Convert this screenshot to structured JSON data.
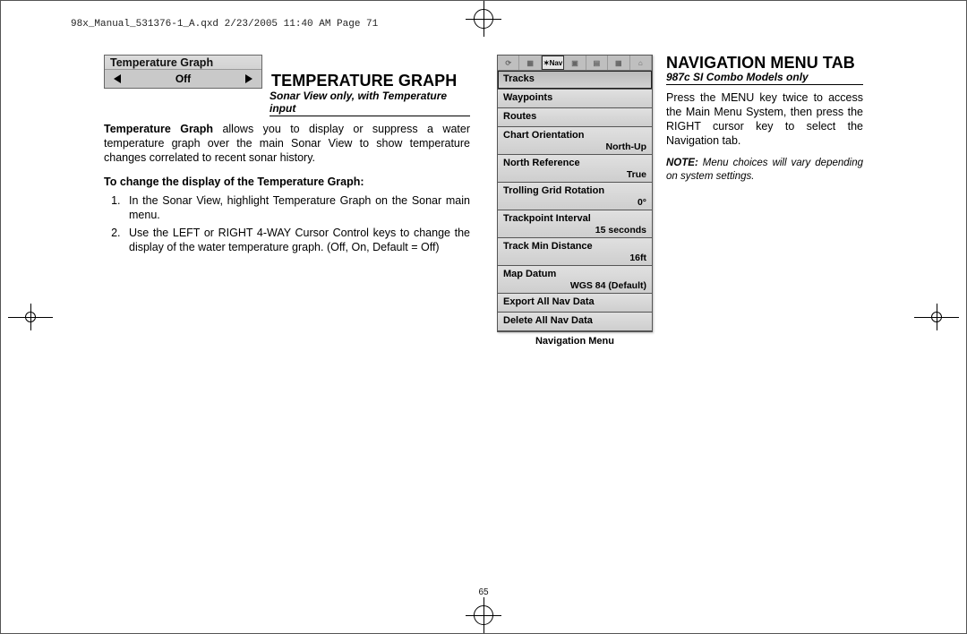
{
  "print_header": "98x_Manual_531376-1_A.qxd  2/23/2005  11:40 AM  Page 71",
  "page_number": "65",
  "left": {
    "widget_title": "Temperature Graph",
    "widget_value": "Off",
    "title": "TEMPERATURE GRAPH",
    "subtitle": "Sonar View only, with Temperature input",
    "intro_bold": "Temperature Graph",
    "intro_rest": " allows you to display or suppress a water temperature graph over the main Sonar View to show temperature changes correlated to recent sonar history.",
    "howto": "To change the display of the Temperature Graph:",
    "steps": [
      "In the Sonar View, highlight Temperature Graph on the Sonar main menu.",
      "Use the LEFT or RIGHT 4-WAY Cursor Control keys to change the display of the water temperature graph. (Off, On, Default = Off)"
    ]
  },
  "right": {
    "title": "NAVIGATION MENU TAB",
    "subtitle": "987c SI Combo Models only",
    "intro": "Press the MENU key twice to access the Main Menu System, then press the RIGHT cursor key to select the Navigation tab.",
    "note_label": "NOTE:",
    "note": " Menu choices will vary depending on system settings.",
    "device_caption": "Navigation Menu",
    "device_tabs": [
      "⟳",
      "▦",
      "✶Nav",
      "▣",
      "▤",
      "▦",
      "⌂"
    ],
    "device_active_tab_index": 2,
    "device_rows": [
      {
        "label": "Tracks",
        "value": "",
        "selected": true
      },
      {
        "label": "Waypoints",
        "value": ""
      },
      {
        "label": "Routes",
        "value": ""
      },
      {
        "label": "Chart Orientation",
        "value": "North-Up"
      },
      {
        "label": "North Reference",
        "value": "True"
      },
      {
        "label": "Trolling Grid Rotation",
        "value": "0°"
      },
      {
        "label": "Trackpoint Interval",
        "value": "15 seconds"
      },
      {
        "label": "Track Min Distance",
        "value": "16ft"
      },
      {
        "label": "Map Datum",
        "value": "WGS 84 (Default)"
      },
      {
        "label": "Export All Nav Data",
        "value": ""
      },
      {
        "label": "Delete All Nav Data",
        "value": ""
      }
    ]
  }
}
